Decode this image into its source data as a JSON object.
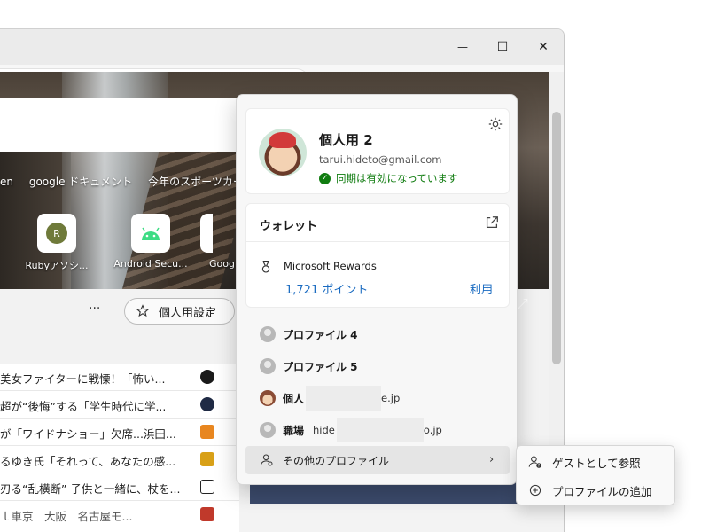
{
  "window": {
    "controls": {
      "minimize": "—",
      "maximize": "☐",
      "close": "✕"
    }
  },
  "toolbar": {
    "icons": [
      "add-favorite-icon",
      "extensions-icon",
      "favorites-icon",
      "collections-icon",
      "browser-essentials-icon",
      "profile-avatar",
      "more-icon"
    ],
    "more_label": "···"
  },
  "newtab": {
    "quick_links": [
      "en",
      "google ドキュメント",
      "今年のスポーツカー..."
    ],
    "tiles": [
      {
        "label": "Rubyアソシ...",
        "initial": "R"
      },
      {
        "label": "Android Secu..."
      },
      {
        "label": "Goog"
      }
    ],
    "feed_more": "···",
    "personalize_label": "個人用設定",
    "news": [
      "美女ファイターに戦慄！「怖い...",
      "超が“後悔”する「学生時代に学...",
      "が「ワイドナショー」欠席...浜田...",
      "るゆき氏「それって、あなたの感...",
      "刃る“乱横断” 子供と一緒に、杖を...",
      "ｌ車京　大阪　名古屋モ..."
    ]
  },
  "flyout": {
    "profile": {
      "name": "個人用 2",
      "email": "tarui.hideto@gmail.com",
      "sync_status": "同期は有効になっています"
    },
    "wallet": {
      "title": "ウォレット",
      "rewards_label": "Microsoft Rewards",
      "points": "1,721 ポイント",
      "use_label": "利用"
    },
    "profiles": [
      {
        "name": "プロファイル 4"
      },
      {
        "name": "プロファイル 5"
      },
      {
        "name": "個人",
        "account_suffix": "e.jp"
      },
      {
        "name": "職場",
        "account_prefix": "hide",
        "account_suffix": "o.jp"
      }
    ],
    "other_profiles_label": "その他のプロファイル"
  },
  "submenu": {
    "browse_as_guest": "ゲストとして参照",
    "add_profile": "プロファイルの追加"
  },
  "colors": {
    "accent_link": "#1a6bc1",
    "sync_green": "#107c10",
    "hover_bg": "#e5e5e5"
  }
}
